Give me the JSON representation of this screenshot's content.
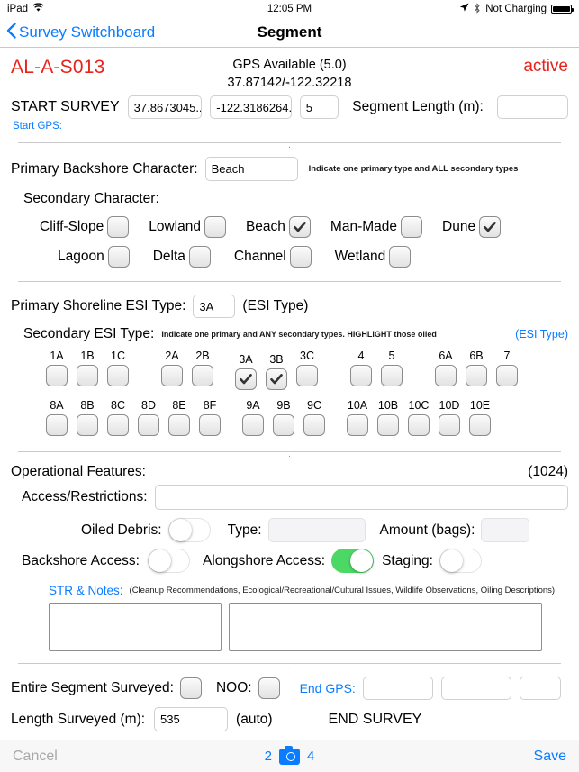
{
  "status_bar": {
    "device": "iPad",
    "wifi_icon": "wifi-icon",
    "time": "12:05 PM",
    "location_icon": "location-arrow-icon",
    "bluetooth_icon": "bluetooth-icon",
    "charging_state": "Not Charging",
    "battery_icon": "battery-icon"
  },
  "nav": {
    "back_icon": "chevron-left-icon",
    "back_label": "Survey Switchboard",
    "title": "Segment"
  },
  "header": {
    "segment_id": "AL-A-S013",
    "gps_status": "GPS Available (5.0)",
    "gps_coords": "37.87142/-122.32218",
    "status": "active",
    "ellipsis": "•••",
    "accent_red": "#e8231b",
    "accent_blue": "#0a7cff"
  },
  "start_survey": {
    "label": "START SURVEY",
    "latitude": "37.8673045...",
    "longitude": "-122.3186264...",
    "accuracy": "5",
    "segment_length_label": "Segment Length (m):",
    "segment_length_value": "",
    "start_gps_label": "Start GPS:"
  },
  "backshore": {
    "primary_label": "Primary Backshore Character:",
    "primary_value": "Beach",
    "hint": "Indicate one primary type and ALL secondary types",
    "secondary_label": "Secondary Character:",
    "row1": [
      {
        "label": "Cliff-Slope",
        "checked": false
      },
      {
        "label": "Lowland",
        "checked": false
      },
      {
        "label": "Beach",
        "checked": true
      },
      {
        "label": "Man-Made",
        "checked": false
      },
      {
        "label": "Dune",
        "checked": true
      }
    ],
    "row2": [
      {
        "label": "Lagoon",
        "checked": false
      },
      {
        "label": "Delta",
        "checked": false
      },
      {
        "label": "Channel",
        "checked": false
      },
      {
        "label": "Wetland",
        "checked": false
      }
    ]
  },
  "esi": {
    "primary_label": "Primary Shoreline ESI Type:",
    "primary_value": "3A",
    "primary_link": "(ESI Type)",
    "secondary_label": "Secondary ESI Type:",
    "secondary_hint": "Indicate one primary and ANY secondary types.   HIGHLIGHT those oiled",
    "secondary_link": "(ESI Type)",
    "row1": [
      {
        "label": "1A",
        "checked": false
      },
      {
        "label": "1B",
        "checked": false
      },
      {
        "label": "1C",
        "checked": false
      },
      {
        "gap": true
      },
      {
        "label": "2A",
        "checked": false
      },
      {
        "label": "2B",
        "checked": false
      },
      {
        "gap_sm": true
      },
      {
        "label": "3A",
        "checked": true
      },
      {
        "label": "3B",
        "checked": true
      },
      {
        "label": "3C",
        "checked": false
      },
      {
        "gap": true
      },
      {
        "label": "4",
        "checked": false
      },
      {
        "label": "5",
        "checked": false
      },
      {
        "gap": true
      },
      {
        "label": "6A",
        "checked": false
      },
      {
        "label": "6B",
        "checked": false
      },
      {
        "label": "7",
        "checked": false
      }
    ],
    "row2": [
      {
        "label": "8A",
        "checked": false
      },
      {
        "label": "8B",
        "checked": false
      },
      {
        "label": "8C",
        "checked": false
      },
      {
        "label": "8D",
        "checked": false
      },
      {
        "label": "8E",
        "checked": false
      },
      {
        "label": "8F",
        "checked": false
      },
      {
        "gap_sm": true
      },
      {
        "label": "9A",
        "checked": false
      },
      {
        "label": "9B",
        "checked": false
      },
      {
        "label": "9C",
        "checked": false
      },
      {
        "gap_sm": true
      },
      {
        "label": "10A",
        "checked": false
      },
      {
        "label": "10B",
        "checked": false
      },
      {
        "label": "10C",
        "checked": false
      },
      {
        "label": "10D",
        "checked": false
      },
      {
        "label": "10E",
        "checked": false
      }
    ]
  },
  "operational": {
    "title": "Operational Features:",
    "char_count": "(1024)",
    "access_label": "Access/Restrictions:",
    "access_value": "",
    "oiled_debris_label": "Oiled Debris:",
    "oiled_debris_on": false,
    "type_label": "Type:",
    "type_value": "",
    "amount_label": "Amount (bags):",
    "amount_value": "",
    "backshore_access_label": "Backshore Access:",
    "backshore_access_on": false,
    "alongshore_access_label": "Alongshore Access:",
    "alongshore_access_on": true,
    "staging_label": "Staging:",
    "staging_on": false,
    "toggle_on_color": "#4cd865"
  },
  "notes": {
    "title": "STR & Notes:",
    "hint": "(Cleanup Recommendations, Ecological/Recreational/Cultural Issues, Wildlife Observations, Oiling Descriptions)",
    "left_value": "",
    "right_value": ""
  },
  "footer": {
    "entire_segment_label": "Entire Segment Surveyed:",
    "entire_segment_checked": false,
    "noo_label": "NOO:",
    "noo_checked": false,
    "end_gps_label": "End GPS:",
    "end_gps_lat": "",
    "end_gps_lon": "",
    "end_gps_acc": "",
    "length_surveyed_label": "Length Surveyed (m):",
    "length_surveyed_value": "535",
    "auto_label": "(auto)",
    "end_survey_label": "END SURVEY"
  },
  "toolbar": {
    "cancel_label": "Cancel",
    "photo_count_left": "2",
    "camera_icon": "camera-icon",
    "photo_count_right": "4",
    "save_label": "Save"
  }
}
